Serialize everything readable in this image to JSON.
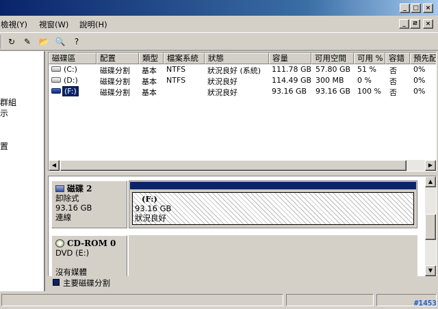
{
  "menu": {
    "view": "檢視(Y)",
    "window": "視窗(W)",
    "help": "說明(H)"
  },
  "window_buttons": {
    "minimize": "_",
    "restore": "□",
    "close": "×"
  },
  "child_window_buttons": {
    "minimize": "_",
    "restore": "ㄹ",
    "close": "×"
  },
  "toolbar": {
    "icons": [
      "refresh-icon",
      "properties-icon",
      "open-folder-icon",
      "find-icon",
      "help-icon"
    ],
    "glyphs": [
      "↻",
      "✎",
      "📂",
      "🔍",
      "?"
    ]
  },
  "tree": {
    "items": [
      "群組",
      "示",
      "置"
    ]
  },
  "volume_list": {
    "columns": [
      "磁碟區",
      "配置",
      "類型",
      "檔案系統",
      "狀態",
      "容量",
      "可用空間",
      "可用 %",
      "容錯",
      "預先配"
    ],
    "rows": [
      {
        "volume": "(C:)",
        "layout": "磁碟分割",
        "type": "基本",
        "fs": "NTFS",
        "status": "狀況良好 (系統)",
        "capacity": "111.78 GB",
        "free": "57.80 GB",
        "free_pct": "51 %",
        "fault": "否",
        "overhead": "0%"
      },
      {
        "volume": "(D:)",
        "layout": "磁碟分割",
        "type": "基本",
        "fs": "NTFS",
        "status": "狀況良好",
        "capacity": "114.49 GB",
        "free": "300 MB",
        "free_pct": "0 %",
        "fault": "否",
        "overhead": "0%"
      },
      {
        "volume": "(F:)",
        "layout": "磁碟分割",
        "type": "基本",
        "fs": "",
        "status": "狀況良好",
        "capacity": "93.16 GB",
        "free": "93.16 GB",
        "free_pct": "100 %",
        "fault": "否",
        "overhead": "0%"
      }
    ]
  },
  "scroll_glyphs": {
    "left": "◀",
    "right": "▶",
    "up": "▲",
    "down": "▼"
  },
  "disks": [
    {
      "name": "磁碟 2",
      "type": "卸除式",
      "size": "93.16 GB",
      "state": "連線"
    },
    {
      "name": "CD-ROM 0",
      "type": "DVD (E:)",
      "size": "",
      "state": "沒有媒體"
    }
  ],
  "partition": {
    "name": "(F:)",
    "size": "93.16 GB",
    "status": "狀況良好"
  },
  "legend": {
    "label": "主要磁碟分割",
    "color": "#0a246a"
  },
  "watermark": "#1453"
}
